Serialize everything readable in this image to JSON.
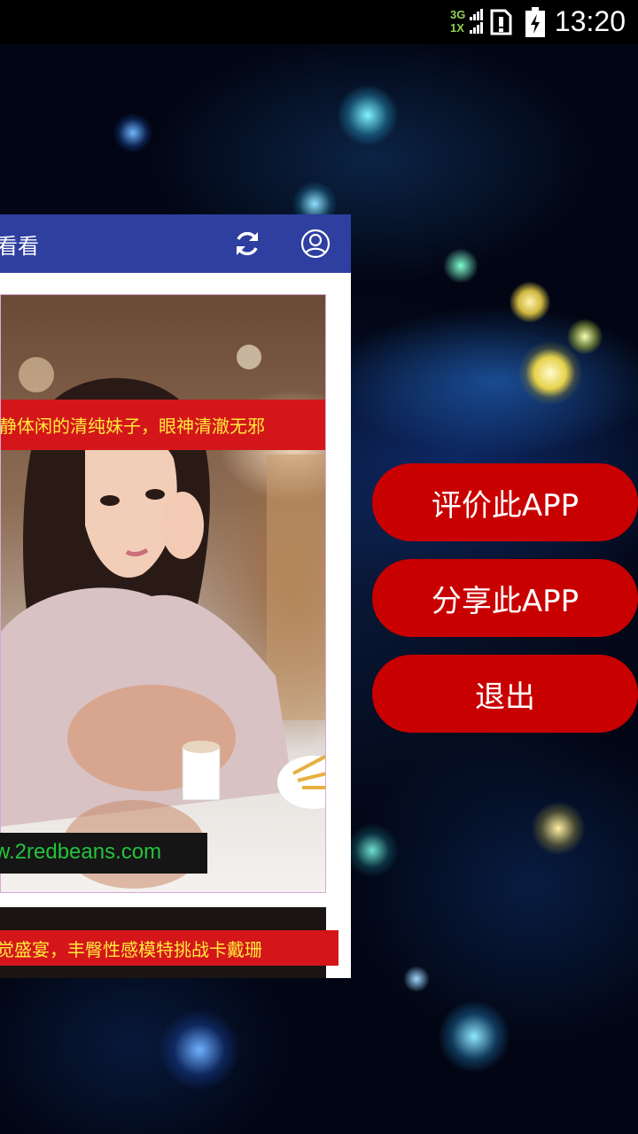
{
  "status_bar": {
    "network_top": "3G",
    "network_bottom": "1X",
    "time": "13:20"
  },
  "app_bar": {
    "title": "看看",
    "refresh_icon": "refresh-icon",
    "user_icon": "user-account-icon",
    "color": "#2e3f9f"
  },
  "feed": {
    "items": [
      {
        "caption": "静体闲的清纯妹子，眼神清澈无邪",
        "watermark": "w.2redbeans.com"
      },
      {
        "caption": "觉盛宴，丰臀性感模特挑战卡戴珊"
      }
    ]
  },
  "menu": {
    "rate_label": "评价此APP",
    "share_label": "分享此APP",
    "exit_label": "退出",
    "button_color": "#c90000"
  }
}
